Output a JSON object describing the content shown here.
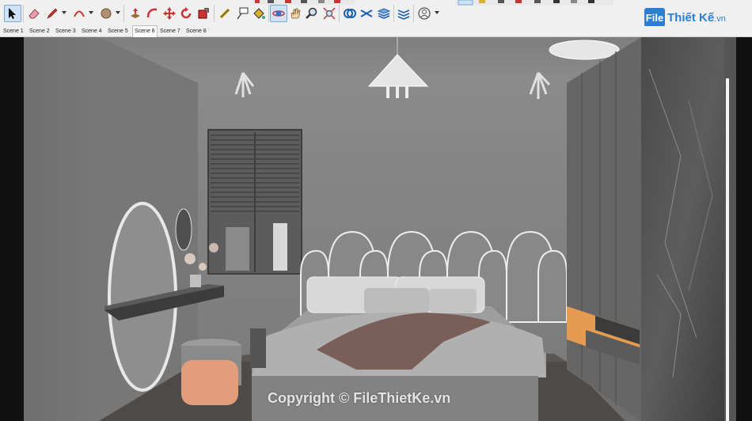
{
  "toolbar": {
    "tools": [
      {
        "name": "select-tool",
        "icon": "arrow-cursor-icon"
      },
      {
        "name": "eraser-tool",
        "icon": "eraser-icon"
      },
      {
        "name": "pencil-tool",
        "icon": "pencil-icon"
      },
      {
        "name": "arc-tool",
        "icon": "arc-icon"
      },
      {
        "name": "shapes-tool",
        "icon": "circle-shape-icon"
      },
      {
        "name": "push-pull-tool",
        "icon": "push-pull-icon"
      },
      {
        "name": "follow-me-tool",
        "icon": "follow-me-icon"
      },
      {
        "name": "move-tool",
        "icon": "move-arrows-icon"
      },
      {
        "name": "rotate-tool",
        "icon": "rotate-icon"
      },
      {
        "name": "scale-tool",
        "icon": "scale-icon"
      },
      {
        "name": "tape-measure-tool",
        "icon": "tape-measure-icon"
      },
      {
        "name": "text-tool",
        "icon": "text-label-icon"
      },
      {
        "name": "paint-bucket-tool",
        "icon": "paint-bucket-icon"
      },
      {
        "name": "orbit-tool",
        "icon": "orbit-icon"
      },
      {
        "name": "pan-tool",
        "icon": "hand-icon"
      },
      {
        "name": "zoom-tool",
        "icon": "magnifier-icon"
      },
      {
        "name": "zoom-extents-tool",
        "icon": "zoom-extents-icon"
      },
      {
        "name": "solid-tools",
        "icon": "solid-tools-icon"
      },
      {
        "name": "sandbox-tool",
        "icon": "sandbox-icon"
      },
      {
        "name": "layers-tool",
        "icon": "layers-icon"
      },
      {
        "name": "styles-tool",
        "icon": "styles-icon"
      },
      {
        "name": "account-menu",
        "icon": "user-circle-icon"
      }
    ],
    "brand": {
      "mark": "File",
      "name": "Thiết Kế",
      "suffix": ".vn"
    }
  },
  "scenes": {
    "tabs": [
      "Scene 1",
      "Scene 2",
      "Scene 3",
      "Scene 4",
      "Scene 5",
      "Scene 6",
      "Scene 7",
      "Scene 8"
    ],
    "active": "Scene 6"
  },
  "viewport": {
    "description_colors": {
      "wall": "#7a7a7a",
      "accent": "#e69b52",
      "panel": "#5b5b5b"
    },
    "watermark": "Copyright © FileThietKe.vn"
  }
}
